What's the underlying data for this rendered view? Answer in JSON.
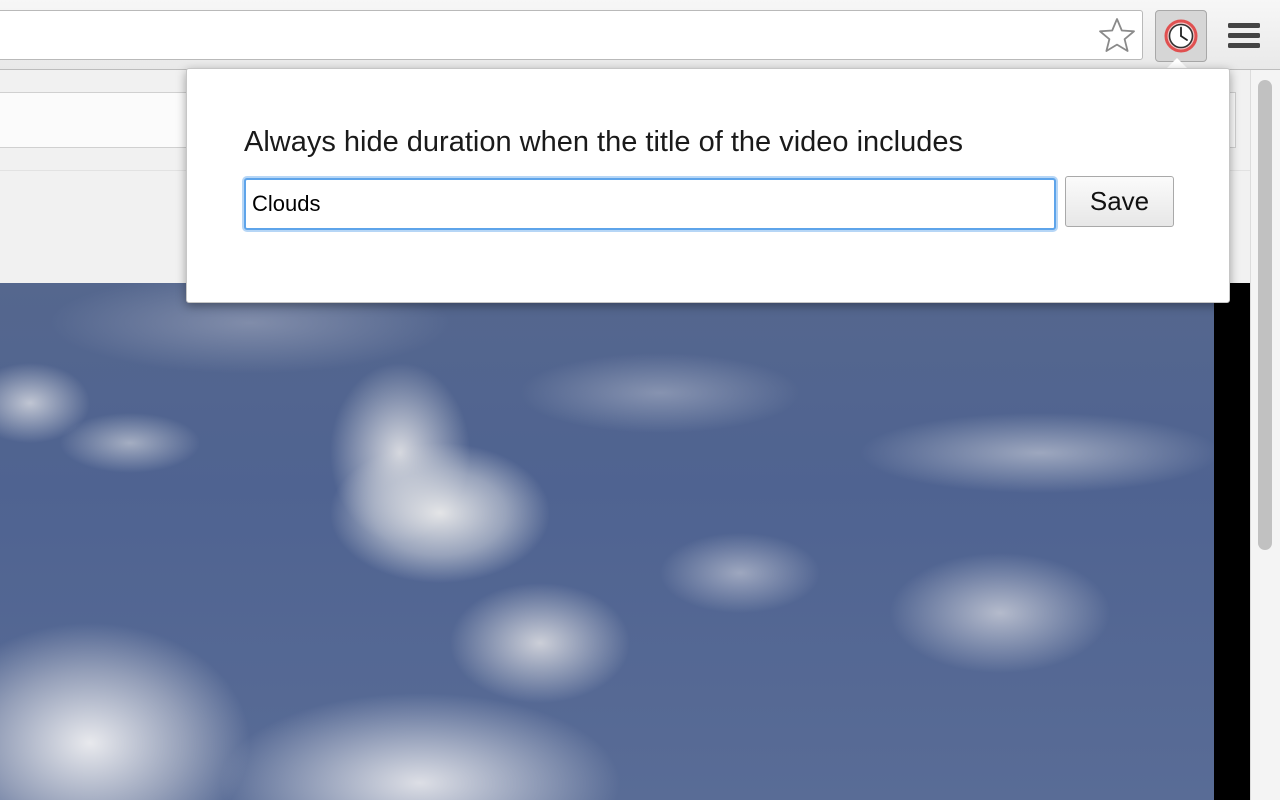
{
  "toolbar": {
    "bookmark_icon": "star-icon",
    "extension_icon": "clock-icon",
    "menu_icon": "hamburger-menu-icon"
  },
  "popup": {
    "label": "Always hide duration when the title of the video includes",
    "input_value": "Clouds",
    "save_label": "Save"
  },
  "colors": {
    "input_focus": "#5ea4ea",
    "extension_icon_accent": "#e05050"
  }
}
